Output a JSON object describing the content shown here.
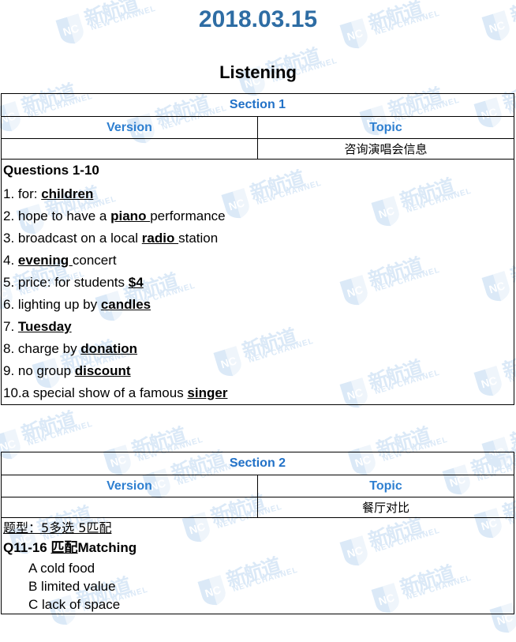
{
  "document": {
    "date": "2018.03.15",
    "subtitle": "Listening"
  },
  "watermark": {
    "cn_text": "新航道",
    "en_text": "NEW CHANNEL",
    "logo_text": "NC",
    "color": "#dbe9f7"
  },
  "colors": {
    "date_blue": "#2e6da4",
    "section_blue": "#2171c7",
    "column_header_blue": "#2e7fd0",
    "border": "#000000",
    "text": "#000000"
  },
  "section1": {
    "title": "Section 1",
    "columns": {
      "version": "Version",
      "topic": "Topic"
    },
    "version_value": "",
    "topic_value": "咨询演唱会信息",
    "questions_heading": "Questions 1-10",
    "questions": [
      {
        "num": "1.",
        "pre": "for: ",
        "answer": "children",
        "post": ""
      },
      {
        "num": "2.",
        "pre": "hope to have a ",
        "answer": "piano ",
        "post": "performance"
      },
      {
        "num": "3.",
        "pre": "broadcast on a local ",
        "answer": "radio ",
        "post": "station"
      },
      {
        "num": "4.",
        "pre": "",
        "answer": "evening ",
        "post": "concert"
      },
      {
        "num": "5.",
        "pre": "price: for students ",
        "answer": "$4",
        "post": ""
      },
      {
        "num": "6.",
        "pre": "lighting up by ",
        "answer": "candles",
        "post": ""
      },
      {
        "num": "7.",
        "pre": "",
        "answer": "Tuesday",
        "post": ""
      },
      {
        "num": "8.",
        "pre": "charge by ",
        "answer": "donation",
        "post": ""
      },
      {
        "num": "9.",
        "pre": "no group ",
        "answer": "discount",
        "post": ""
      },
      {
        "num": "10.",
        "pre": "a special show of a famous ",
        "answer": "singer",
        "post": ""
      }
    ]
  },
  "section2": {
    "title": "Section 2",
    "columns": {
      "version": "Version",
      "topic": "Topic"
    },
    "version_value": "",
    "topic_value": "餐厅对比",
    "type_line": "题型：5多选 5匹配",
    "match_heading_prefix": "Q11-16 ",
    "match_heading_cn": "匹配",
    "match_heading_en": "Matching",
    "options": [
      "A cold food",
      "B limited value",
      "C lack of space"
    ]
  }
}
